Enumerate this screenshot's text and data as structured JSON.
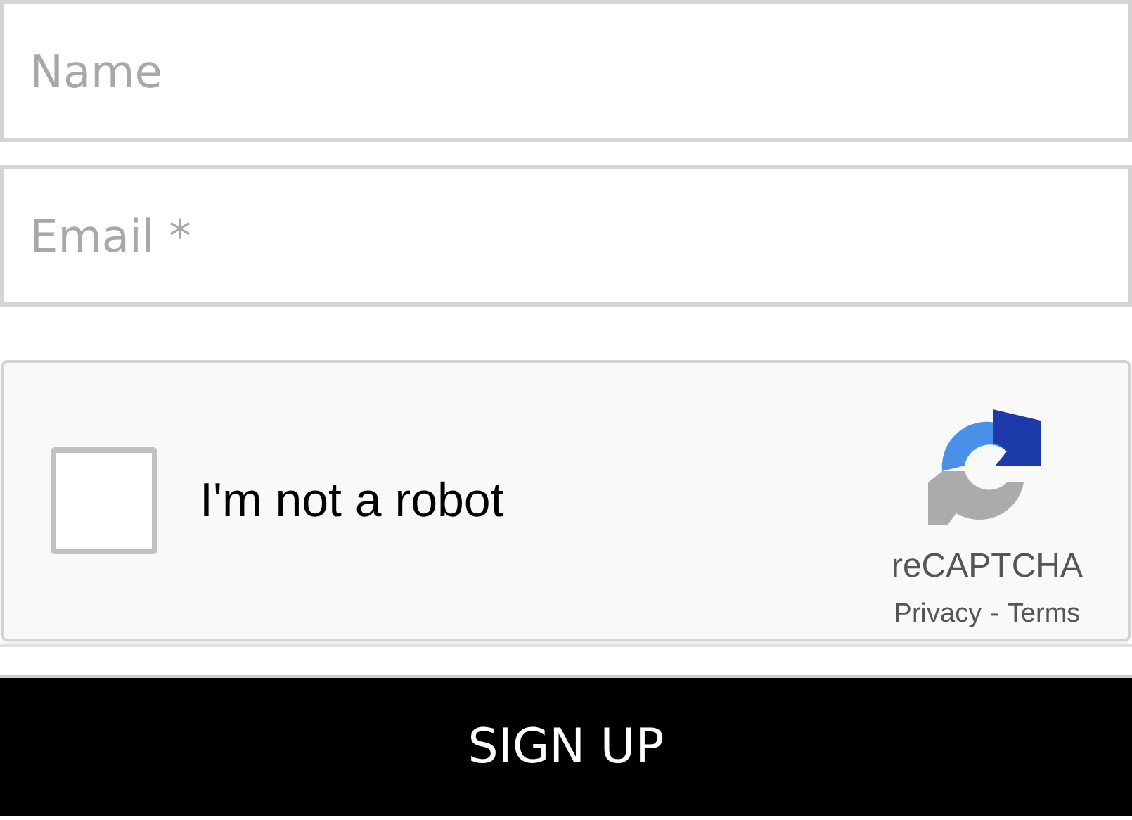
{
  "fields": [
    {
      "placeholder": "Name"
    },
    {
      "placeholder": "Email *"
    }
  ],
  "captcha": {
    "checked": false,
    "label": "I'm not a robot",
    "brand": "reCAPTCHA",
    "links": [
      "Privacy",
      "Terms"
    ],
    "separator": "-"
  },
  "submit": "SIGN UP"
}
